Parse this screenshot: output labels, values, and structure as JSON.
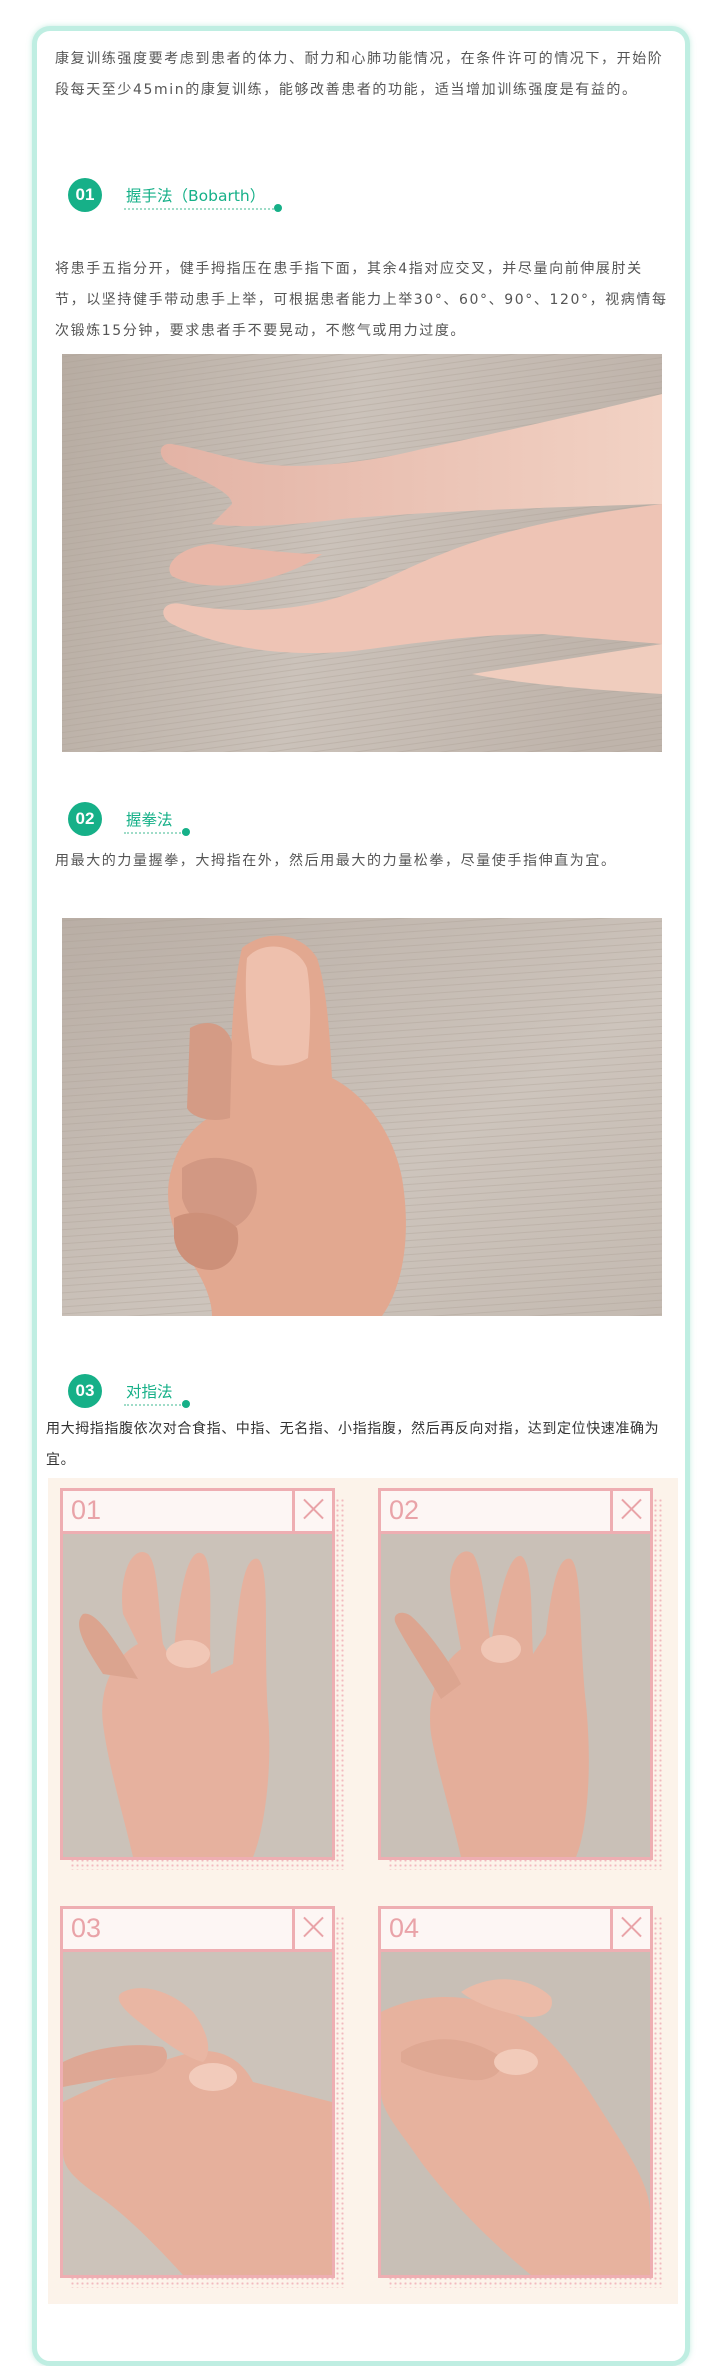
{
  "intro": "康复训练强度要考虑到患者的体力、耐力和心肺功能情况，在条件许可的情况下，开始阶段每天至少45min的康复训练，能够改善患者的功能，适当增加训练强度是有益的。",
  "sections": [
    {
      "number": "01",
      "title": "握手法（Bobarth）",
      "text": "将患手五指分开，健手拇指压在患手指下面，其余4指对应交叉，并尽量向前伸展肘关节，以坚持健手带动患手上举，可根据患者能力上举30°、60°、90°、120°，视病情每次锻炼15分钟，要求患者手不要晃动，不憋气或用力过度。"
    },
    {
      "number": "02",
      "title": "握拳法",
      "text": "用最大的力量握拳，大拇指在外，然后用最大的力量松拳，尽量使手指伸直为宜。"
    },
    {
      "number": "03",
      "title": "对指法",
      "text": "用大拇指指腹依次对合食指、中指、无名指、小指指腹，然后再反向对指，达到定位快速准确为宜。"
    }
  ],
  "steps": [
    "01",
    "02",
    "03",
    "04"
  ]
}
